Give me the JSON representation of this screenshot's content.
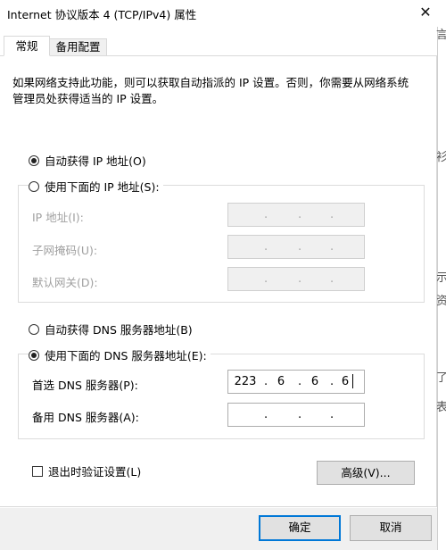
{
  "window": {
    "title": "Internet 协议版本 4 (TCP/IPv4) 属性",
    "close_glyph": "✕"
  },
  "tabs": [
    {
      "label": "常规",
      "active": true
    },
    {
      "label": "备用配置",
      "active": false
    }
  ],
  "description": "如果网络支持此功能，则可以获取自动指派的 IP 设置。否则，你需要从网络系统管理员处获得适当的 IP 设置。",
  "ip_section": {
    "auto_option": {
      "label": "自动获得 IP 地址(O)",
      "selected": true
    },
    "manual_option": {
      "label": "使用下面的 IP 地址(S):",
      "selected": false
    },
    "fields": [
      {
        "label": "IP 地址(I):",
        "value": ". . .",
        "enabled": false
      },
      {
        "label": "子网掩码(U):",
        "value": ". . .",
        "enabled": false
      },
      {
        "label": "默认网关(D):",
        "value": ". . .",
        "enabled": false
      }
    ]
  },
  "dns_section": {
    "auto_option": {
      "label": "自动获得 DNS 服务器地址(B)",
      "selected": false
    },
    "manual_option": {
      "label": "使用下面的 DNS 服务器地址(E):",
      "selected": true
    },
    "preferred": {
      "label": "首选 DNS 服务器(P):",
      "octets": [
        "223",
        "6",
        "6",
        "6"
      ]
    },
    "alternate": {
      "label": "备用 DNS 服务器(A):",
      "octets": [
        "",
        "",
        "",
        ""
      ]
    }
  },
  "validate_checkbox": {
    "label": "退出时验证设置(L)",
    "checked": false
  },
  "buttons": {
    "advanced": "高级(V)...",
    "ok": "确定",
    "cancel": "取消"
  },
  "background_glyphs": [
    "言",
    "衫",
    "示",
    "资",
    "了",
    "表"
  ],
  "colors": {
    "accent": "#0078d7",
    "disabled_bg": "#f0f0f0",
    "button_bg": "#e1e1e1"
  }
}
